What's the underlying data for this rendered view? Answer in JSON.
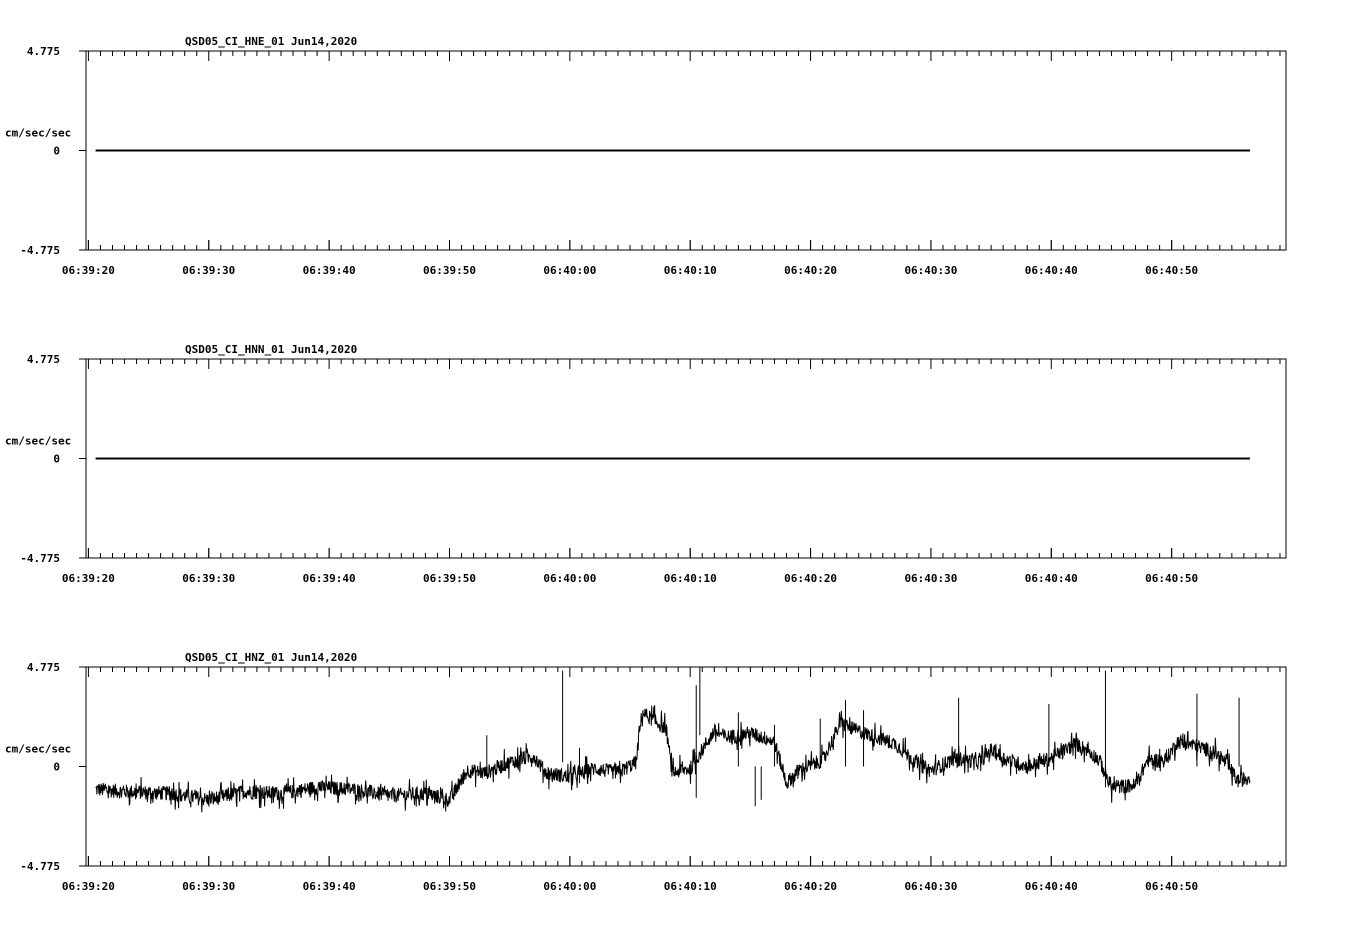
{
  "chart_data": [
    {
      "type": "line",
      "title": "QSD05_CI_HNE_01  Jun14,2020",
      "ylabel": "cm/sec/sec",
      "ylim": [
        -4.775,
        4.775
      ],
      "yticks": [
        "4.775",
        "0",
        "-4.775"
      ],
      "x_tick_labels": [
        "06:39:20",
        "06:39:30",
        "06:39:40",
        "06:39:50",
        "06:40:00",
        "06:40:10",
        "06:40:20",
        "06:40:30",
        "06:40:40",
        "06:40:50"
      ],
      "xlim_seconds": [
        -0.2,
        99.5
      ],
      "trace": {
        "start": 0.6,
        "end": 96.5,
        "level": 0.0,
        "noise": 0.0,
        "events": []
      }
    },
    {
      "type": "line",
      "title": "QSD05_CI_HNN_01  Jun14,2020",
      "ylabel": "cm/sec/sec",
      "ylim": [
        -4.775,
        4.775
      ],
      "yticks": [
        "4.775",
        "0",
        "-4.775"
      ],
      "x_tick_labels": [
        "06:39:20",
        "06:39:30",
        "06:39:40",
        "06:39:50",
        "06:40:00",
        "06:40:10",
        "06:40:20",
        "06:40:30",
        "06:40:40",
        "06:40:50"
      ],
      "xlim_seconds": [
        -0.2,
        99.5
      ],
      "trace": {
        "start": 0.6,
        "end": 96.5,
        "level": 0.0,
        "noise": 0.0,
        "events": []
      }
    },
    {
      "type": "line",
      "title": "QSD05_CI_HNZ_01  Jun14,2020",
      "ylabel": "cm/sec/sec",
      "ylim": [
        -4.775,
        4.775
      ],
      "yticks": [
        "4.775",
        "0",
        "-4.775"
      ],
      "x_tick_labels": [
        "06:39:20",
        "06:39:30",
        "06:39:40",
        "06:39:50",
        "06:40:00",
        "06:40:10",
        "06:40:20",
        "06:40:30",
        "06:40:40",
        "06:40:50"
      ],
      "xlim_seconds": [
        -0.2,
        99.5
      ],
      "trace": {
        "start": 0.6,
        "end": 96.5,
        "noise": 0.35,
        "baseline": [
          [
            0.6,
            -1.1
          ],
          [
            3,
            -1.2
          ],
          [
            7,
            -1.3
          ],
          [
            10,
            -1.6
          ],
          [
            13,
            -1.2
          ],
          [
            16,
            -1.3
          ],
          [
            19,
            -1.0
          ],
          [
            22,
            -1.1
          ],
          [
            25,
            -1.4
          ],
          [
            28,
            -1.3
          ],
          [
            30,
            -1.6
          ],
          [
            31.5,
            -0.2
          ],
          [
            33,
            -0.3
          ],
          [
            35,
            0.2
          ],
          [
            37,
            0.5
          ],
          [
            38,
            -0.3
          ],
          [
            40,
            -0.5
          ],
          [
            42,
            -0.1
          ],
          [
            44,
            -0.3
          ],
          [
            45.5,
            0.2
          ],
          [
            46,
            2.6
          ],
          [
            47,
            2.2
          ],
          [
            48,
            1.8
          ],
          [
            48.5,
            -0.3
          ],
          [
            50,
            -0.1
          ],
          [
            52,
            1.7
          ],
          [
            53,
            1.4
          ],
          [
            55,
            1.6
          ],
          [
            57,
            1.2
          ],
          [
            58,
            -0.8
          ],
          [
            59,
            -0.2
          ],
          [
            61,
            0.3
          ],
          [
            62.5,
            2.1
          ],
          [
            63.5,
            1.8
          ],
          [
            65,
            1.5
          ],
          [
            66,
            1.3
          ],
          [
            67,
            1.1
          ],
          [
            68,
            0.6
          ],
          [
            69,
            0.1
          ],
          [
            70,
            -0.2
          ],
          [
            72,
            0.4
          ],
          [
            74,
            0.2
          ],
          [
            75,
            0.8
          ],
          [
            76,
            0.4
          ],
          [
            78,
            0.0
          ],
          [
            80,
            0.4
          ],
          [
            82,
            1.1
          ],
          [
            83,
            0.8
          ],
          [
            84,
            0.3
          ],
          [
            85,
            -1.0
          ],
          [
            87,
            -0.9
          ],
          [
            88,
            0.3
          ],
          [
            89.5,
            0.3
          ],
          [
            90.5,
            1.2
          ],
          [
            92,
            1.0
          ],
          [
            93.5,
            0.7
          ],
          [
            94.5,
            0.2
          ],
          [
            95.5,
            -0.7
          ],
          [
            96.5,
            -0.5
          ]
        ],
        "events": [
          [
            33.1,
            -0.5,
            1.5
          ],
          [
            39.4,
            0.2,
            4.6
          ],
          [
            40.8,
            -0.8,
            0.9
          ],
          [
            50.5,
            -1.5,
            3.9
          ],
          [
            50.8,
            1.5,
            4.775
          ],
          [
            54.0,
            0.0,
            2.6
          ],
          [
            55.4,
            0.0,
            -1.9
          ],
          [
            55.9,
            0.0,
            -1.6
          ],
          [
            57.0,
            0.0,
            2.0
          ],
          [
            60.8,
            0.0,
            2.3
          ],
          [
            62.9,
            0.0,
            3.2
          ],
          [
            64.4,
            0.0,
            2.7
          ],
          [
            72.3,
            0.0,
            3.3
          ],
          [
            79.8,
            0.0,
            3.0
          ],
          [
            84.5,
            -1.0,
            4.6
          ],
          [
            92.1,
            0.0,
            3.5
          ],
          [
            95.6,
            0.0,
            3.3
          ]
        ]
      }
    }
  ]
}
